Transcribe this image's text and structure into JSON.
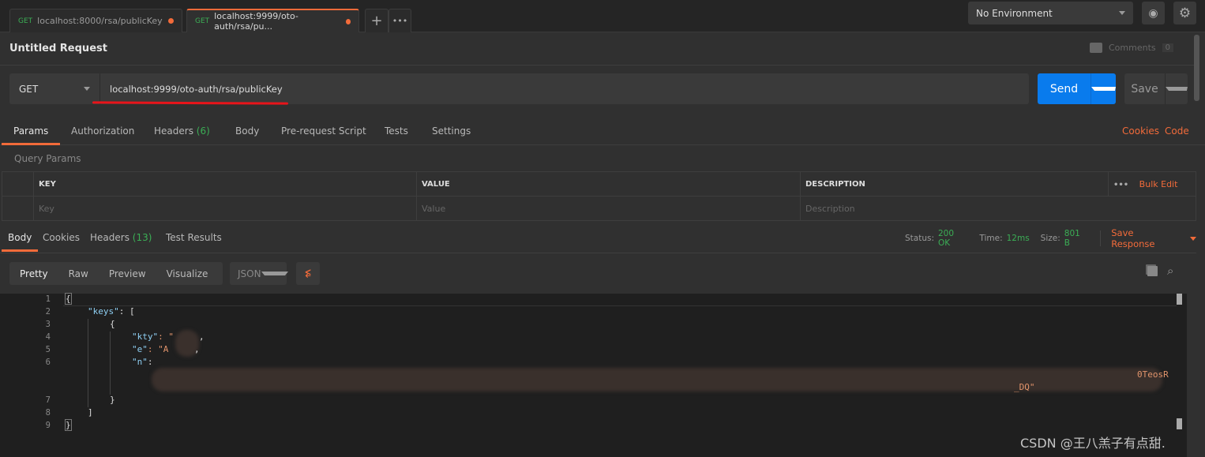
{
  "tabs": [
    {
      "method": "GET",
      "label": "localhost:8000/rsa/publicKey",
      "unsaved": true
    },
    {
      "method": "GET",
      "label": "localhost:9999/oto-auth/rsa/pu...",
      "unsaved": true,
      "active": true
    }
  ],
  "environment": {
    "selected": "No Environment"
  },
  "request": {
    "title": "Untitled Request",
    "comments_label": "Comments",
    "comments_count": "0",
    "method": "GET",
    "url": "localhost:9999/oto-auth/rsa/publicKey",
    "send_label": "Send",
    "save_label": "Save"
  },
  "request_tabs": [
    {
      "label": "Params",
      "active": true
    },
    {
      "label": "Authorization"
    },
    {
      "label": "Headers",
      "count": "(6)"
    },
    {
      "label": "Body"
    },
    {
      "label": "Pre-request Script"
    },
    {
      "label": "Tests"
    },
    {
      "label": "Settings"
    }
  ],
  "request_links": {
    "cookies": "Cookies",
    "code": "Code"
  },
  "params": {
    "title": "Query Params",
    "columns": [
      "KEY",
      "VALUE",
      "DESCRIPTION"
    ],
    "bulk_edit": "Bulk Edit",
    "placeholders": {
      "key": "Key",
      "value": "Value",
      "description": "Description"
    }
  },
  "response_tabs": [
    {
      "label": "Body",
      "active": true
    },
    {
      "label": "Cookies"
    },
    {
      "label": "Headers",
      "count": "(13)"
    },
    {
      "label": "Test Results"
    }
  ],
  "response_status": {
    "status_label": "Status:",
    "status": "200 OK",
    "time_label": "Time:",
    "time": "12ms",
    "size_label": "Size:",
    "size": "801 B",
    "save_response": "Save Response"
  },
  "view_modes": [
    "Pretty",
    "Raw",
    "Preview",
    "Visualize"
  ],
  "format": "JSON",
  "code": {
    "line_numbers": [
      "1",
      "2",
      "3",
      "4",
      "5",
      "6",
      "7",
      "8",
      "9"
    ],
    "l1": "{",
    "l2_key": "\"keys\"",
    "l2_rest": ": [",
    "l3": "{",
    "l4_key": "\"kty\"",
    "l4_val": ": \"",
    "l5_key": "\"e\"",
    "l5_val": ": \"A",
    "l6_key": "\"n\"",
    "l6_rest": ":",
    "n_tail1": "0TeosR",
    "n_tail2": "_DQ\"",
    "l7": "}",
    "l8": "]",
    "l9": "}"
  },
  "watermark": "CSDN @王八羔子有点甜.",
  "colors": {
    "accent": "#f26b3a",
    "send": "#097bed",
    "success": "#3bae55"
  }
}
